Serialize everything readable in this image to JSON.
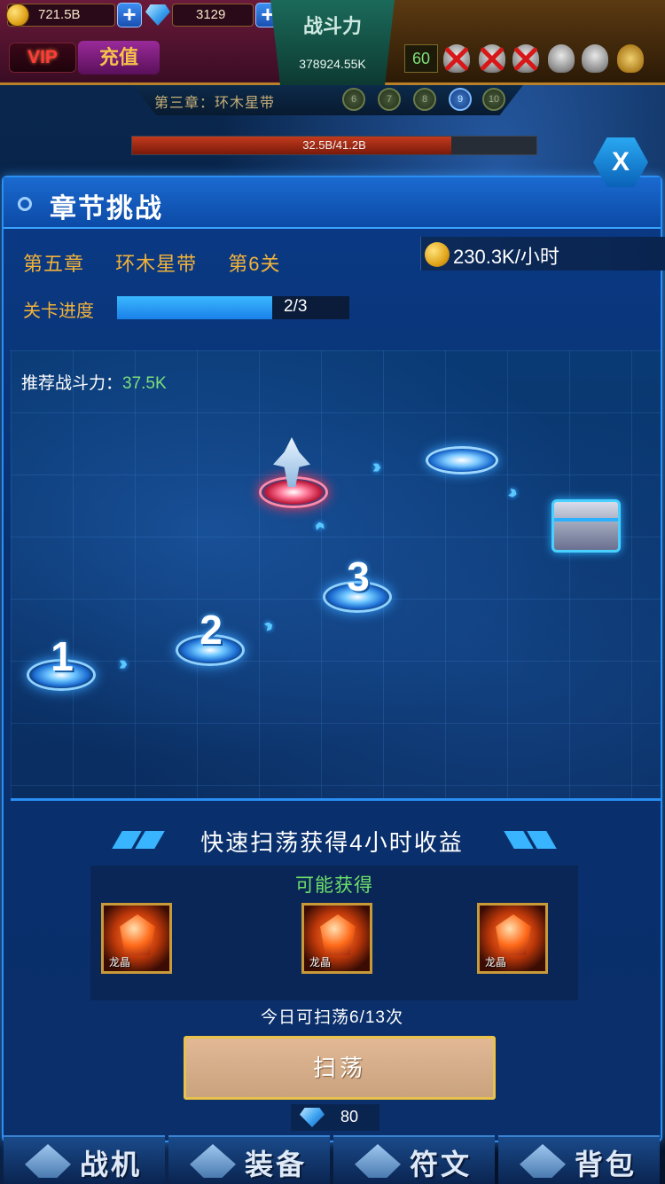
{
  "hud": {
    "coins": "721.5B",
    "gems": "3129",
    "vip_label": "VIP",
    "recharge_label": "充值",
    "power_title": "战斗力",
    "power_value": "378924.55K",
    "level": "60",
    "chapter_strip": "第三章：环木星带",
    "chapter_stages": [
      "6",
      "7",
      "8",
      "9",
      "10"
    ],
    "boss_hp_text": "32.5B/41.2B",
    "boss_hp_fraction": 0.79
  },
  "dialog": {
    "title": "章节挑战",
    "close_label": "X",
    "chapter": "第五章",
    "region": "环木星带",
    "stage": "第6关",
    "income": "230.3K/小时",
    "progress_label": "关卡进度",
    "progress_text": "2/3",
    "progress_fraction": 0.667,
    "recommend_label": "推荐战斗力：",
    "recommend_value": "37.5K",
    "nodes": [
      "1",
      "2",
      "3"
    ],
    "sweep_title": "快速扫荡获得4小时收益",
    "rewards_label": "可能获得",
    "rewards": [
      {
        "name": "龙晶"
      },
      {
        "name": "龙晶"
      },
      {
        "name": "龙晶"
      }
    ],
    "sweep_count": "今日可扫荡6/13次",
    "sweep_button": "扫荡",
    "sweep_cost": "80"
  },
  "bottom_nav": [
    {
      "label": "战机",
      "icon": "fighter-icon"
    },
    {
      "label": "装备",
      "icon": "equipment-icon"
    },
    {
      "label": "符文",
      "icon": "rune-icon"
    },
    {
      "label": "背包",
      "icon": "backpack-icon"
    }
  ],
  "colors": {
    "accent_blue": "#2a8ef2",
    "gold_text": "#f2b23a",
    "green_text": "#6ee06a",
    "button_tan": "#c9a27e"
  }
}
